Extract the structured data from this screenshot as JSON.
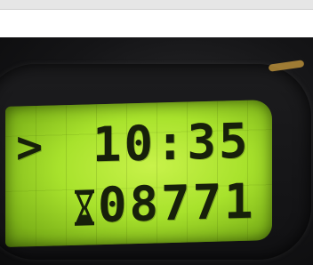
{
  "display": {
    "row1": {
      "arrow": ">",
      "time": "10:35"
    },
    "row2": {
      "icon": "hourglass-icon",
      "counter": "08771"
    }
  },
  "colors": {
    "lcd_backlight": "#a8e22c",
    "lcd_text": "#17200a",
    "bezel": "#151517"
  }
}
